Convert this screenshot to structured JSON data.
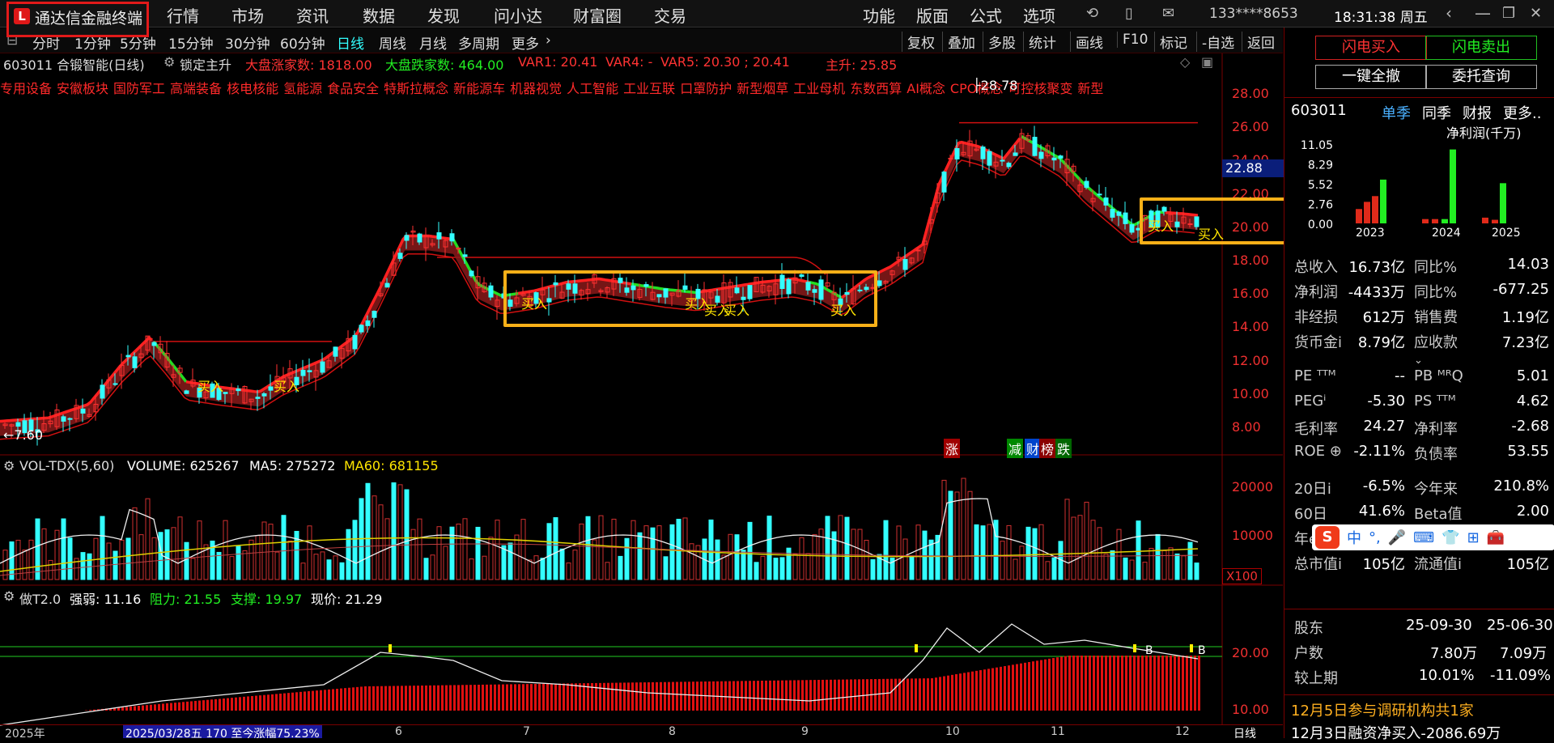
{
  "app": {
    "title": "通达信金融终端"
  },
  "menu": [
    "行情",
    "市场",
    "资讯",
    "数据",
    "发现",
    "问小达",
    "财富圈",
    "交易"
  ],
  "right_menu": [
    "功能",
    "版面",
    "公式",
    "选项"
  ],
  "account": "133****8653",
  "clock": "18:31:38 周五",
  "timeframes": [
    "分时",
    "1分钟",
    "5分钟",
    "15分钟",
    "30分钟",
    "60分钟",
    "日线",
    "周线",
    "月线",
    "多周期",
    "更多"
  ],
  "active_timeframe": "日线",
  "toolbar_right": [
    "复权",
    "叠加",
    "多股",
    "统计",
    "画线",
    "F10",
    "标记",
    "-自选",
    "返回"
  ],
  "stock": {
    "code_name": "603011 合锻智能(日线)",
    "lock": "锁定主升",
    "up_label": "大盘涨家数: 1818.00",
    "down_label": "大盘跌家数: 464.00",
    "var1": "VAR1: 20.41",
    "var4": "VAR4: -",
    "var5": "VAR5: 20.30 ; 20.41",
    "zhusheng": "主升: 25.85"
  },
  "tags": [
    "专用设备",
    "安徽板块",
    "国防军工",
    "高端装备",
    "核电核能",
    "氢能源",
    "食品安全",
    "特斯拉概念",
    "新能源车",
    "机器视觉",
    "人工智能",
    "工业互联",
    "口罩防护",
    "新型烟草",
    "工业母机",
    "东数西算",
    "AI概念",
    "CPO概念",
    "可控核聚变",
    "新型"
  ],
  "price_axis": [
    "28.00",
    "26.00",
    "24.00",
    "22.00",
    "20.00",
    "18.00",
    "16.00",
    "14.00",
    "12.00",
    "10.00",
    "8.00"
  ],
  "price_marker": "22.88",
  "high_label": "28.78",
  "low_label": "7.60",
  "buy_label": "买入",
  "events": {
    "zhang": "涨",
    "jian": "减",
    "cai": "财",
    "bang": "榜",
    "die": "跌"
  },
  "vol": {
    "title": "VOL-TDX(5,60)",
    "volume": "VOLUME: 625267",
    "ma5": "MA5: 275272",
    "ma60": "MA60: 681155",
    "axis": [
      "20000",
      "10000"
    ],
    "unit": "X100"
  },
  "ind": {
    "name": "做T2.0",
    "strength": "强弱: 11.16",
    "resist": "阻力: 21.55",
    "support": "支撑: 19.97",
    "price": "现价: 21.29",
    "axis": [
      "20.00",
      "10.00"
    ],
    "b_label": "B"
  },
  "time_axis": {
    "year": "2025年",
    "range": "2025/03/28五 170 至今涨幅75.23%",
    "months": [
      "6",
      "7",
      "8",
      "9",
      "10",
      "11",
      "12"
    ],
    "period": "日线"
  },
  "trade": {
    "buy": "闪电买入",
    "sell": "闪电卖出",
    "cancel": "一键全撤",
    "query": "委托查询"
  },
  "fin": {
    "code": "603011",
    "tabs": [
      "单季",
      "同季",
      "财报",
      "更多.."
    ],
    "chart_title": "净利润(千万)",
    "rows": [
      {
        "l1": "总收入",
        "v1": "16.73亿",
        "l2": "同比%",
        "v2": "14.03"
      },
      {
        "l1": "净利润",
        "v1": "-4433万",
        "l2": "同比%",
        "v2": "-677.25"
      },
      {
        "l1": "非经损",
        "v1": "612万",
        "l2": "销售费",
        "v2": "1.19亿"
      },
      {
        "l1": "货币金i",
        "v1": "8.79亿",
        "l2": "应收款",
        "v2": "7.23亿"
      }
    ],
    "rows2": [
      {
        "l1": "PE ᵀᵀᴹ",
        "v1": "--",
        "l2": "PB ᴹᴿQ",
        "v2": "5.01"
      },
      {
        "l1": "PEGⁱ",
        "v1": "-5.30",
        "l2": "PS ᵀᵀᴹ",
        "v2": "4.62"
      },
      {
        "l1": "毛利率",
        "v1": "24.27",
        "l2": "净利率",
        "v2": "-2.68"
      },
      {
        "l1": "ROE ⊕",
        "v1": "-2.11%",
        "l2": "负债率",
        "v2": "53.55"
      }
    ],
    "rows3": [
      {
        "l1": "20日i",
        "v1": "-6.5%",
        "l2": "今年来",
        "v2": "210.8%"
      },
      {
        "l1": "60日",
        "v1": "41.6%",
        "l2": "Beta值",
        "v2": "2.00"
      },
      {
        "l1": "年essen",
        "v1": "",
        "l2": "",
        "v2": ""
      },
      {
        "l1": "总市值i",
        "v1": "105亿",
        "l2": "流通值i",
        "v2": "105亿"
      }
    ],
    "holders": {
      "label": "股东",
      "d1": "25-09-30",
      "d2": "25-06-30"
    },
    "holders_rows": [
      {
        "l": "户数",
        "v1": "7.80万",
        "v2": "7.09万"
      },
      {
        "l": "较上期",
        "v1": "10.01%",
        "v2": "-11.09%"
      }
    ],
    "news": [
      "12月5日参与调研机构共1家",
      "12月3日融资净买入-2086.69万"
    ]
  },
  "chart_data": {
    "type": "bar",
    "title": "净利润(千万)",
    "y_ticks": [
      "11.05",
      "8.29",
      "5.52",
      "2.76",
      "0.00"
    ],
    "categories": [
      "2023",
      "2024",
      "2025"
    ],
    "values": [
      2.0,
      3.0,
      3.8,
      6.1,
      0.6,
      0.6,
      0.6,
      10.3,
      0.8,
      0.5,
      5.6
    ]
  },
  "ime": {
    "items": [
      "中",
      "°,",
      "🎤",
      "⌨",
      "👕",
      "⊞",
      "🧰"
    ]
  }
}
